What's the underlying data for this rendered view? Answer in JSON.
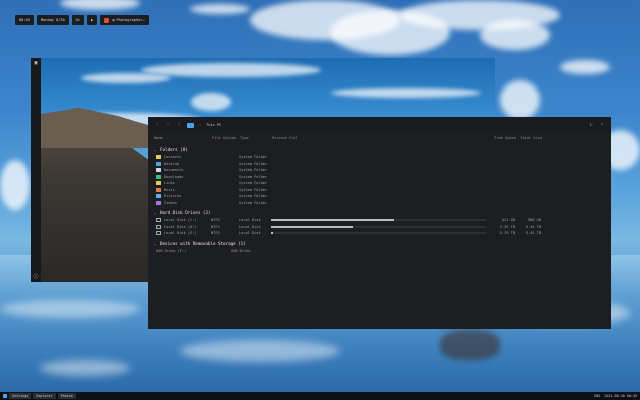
{
  "topbar": {
    "time": "08:49",
    "date": "Monday 8/30",
    "workspace": "01",
    "play_icon": "play-icon",
    "media_text": "◀ Photographer…"
  },
  "viewer": {
    "rail_icons": [
      "image-icon",
      "info-icon"
    ]
  },
  "file_manager": {
    "toolbar": {
      "back_icon": "arrow-left-icon",
      "forward_icon": "arrow-right-icon",
      "up_icon": "arrow-up-icon",
      "location": "This PC",
      "refresh_icon": "refresh-icon",
      "search_icon": "search-icon"
    },
    "columns": {
      "name": "Name",
      "file_system": "File System",
      "type": "Type",
      "percent_full": "Percent Full",
      "free_space": "Free Space",
      "total_size": "Total Size"
    },
    "folders_section": "Folders (8)",
    "folders": [
      {
        "name": "Contacts",
        "type": "System Folder",
        "color": "#e8c95c"
      },
      {
        "name": "Desktop",
        "type": "System Folder",
        "color": "#4aa3e8"
      },
      {
        "name": "Documents",
        "type": "System Folder",
        "color": "#d7d9dc"
      },
      {
        "name": "Downloads",
        "type": "System Folder",
        "color": "#3dbf7a"
      },
      {
        "name": "Links",
        "type": "System Folder",
        "color": "#e8c95c"
      },
      {
        "name": "Music",
        "type": "System Folder",
        "color": "#e57a4a"
      },
      {
        "name": "Pictures",
        "type": "System Folder",
        "color": "#5ab3e8"
      },
      {
        "name": "Videos",
        "type": "System Folder",
        "color": "#9f7ae3"
      }
    ],
    "drives_section": "Hard Disk Drives (3)",
    "drives": [
      {
        "name": "Local Disk (C:)",
        "fs": "NTFS",
        "type": "Local Disk",
        "percent_full": 57,
        "free": "421 GB",
        "total": "988 GB"
      },
      {
        "name": "Local Disk (D:)",
        "fs": "NTFS",
        "type": "Local Disk",
        "percent_full": 38,
        "free": "3.39 TB",
        "total": "5.45 TB"
      },
      {
        "name": "Local Disk (E:)",
        "fs": "NTFS",
        "type": "Local Disk",
        "percent_full": 1,
        "free": "5.39 TB",
        "total": "5.45 TB"
      }
    ],
    "removable_section": "Devices with Removable Storage (1)",
    "removable": [
      {
        "name": "USB Drive (F:)",
        "type": "USB Drive"
      }
    ]
  },
  "taskbar": {
    "start_icon": "windows-icon",
    "apps": [
      "Settings",
      "Explorer",
      "Photos"
    ],
    "tray": [
      "ENG",
      "2021-08-30 08:49"
    ]
  }
}
